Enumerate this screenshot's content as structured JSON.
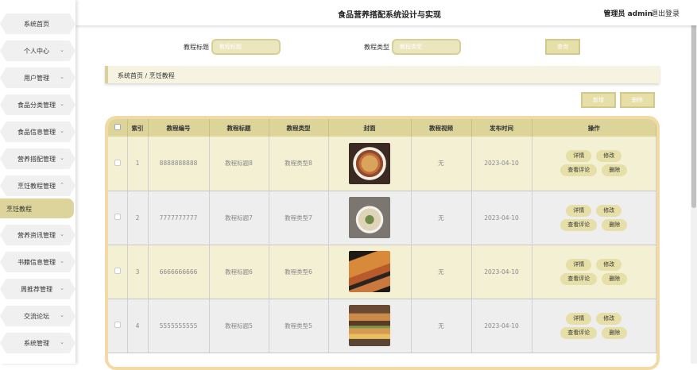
{
  "header": {
    "title": "食品营养搭配系统设计与实现",
    "user": "管理员 admin",
    "logout": "退出登录"
  },
  "sidebar": {
    "items": [
      {
        "label": "系统首页",
        "chevron": false
      },
      {
        "label": "个人中心",
        "chevron": true
      },
      {
        "label": "用户管理",
        "chevron": true
      },
      {
        "label": "食品分类管理",
        "chevron": true
      },
      {
        "label": "食品信息管理",
        "chevron": true
      },
      {
        "label": "营养搭配管理",
        "chevron": true
      },
      {
        "label": "烹饪教程管理",
        "chevron": true,
        "expanded": true
      },
      {
        "label": "营养资讯管理",
        "chevron": true
      },
      {
        "label": "书籍信息管理",
        "chevron": true
      },
      {
        "label": "周推荐管理",
        "chevron": true
      },
      {
        "label": "交流论坛",
        "chevron": true
      },
      {
        "label": "系统管理",
        "chevron": true
      }
    ],
    "active_sub": "烹饪教程"
  },
  "search": {
    "title_label": "教程标题",
    "title_placeholder": "教程标题",
    "type_label": "教程类型",
    "type_placeholder": "教程类型",
    "query_button": "查询"
  },
  "breadcrumb": {
    "text": "系统首页 / 烹饪教程"
  },
  "actions": {
    "add": "新增",
    "delete": "删除"
  },
  "table": {
    "headers": [
      "索引",
      "教程编号",
      "教程标题",
      "教程类型",
      "封面",
      "教程视频",
      "发布时间",
      "操作"
    ],
    "rows": [
      {
        "index": "1",
        "code": "8888888888",
        "title": "教程标题8",
        "type": "教程类型8",
        "video": "无",
        "date": "2023-04-10",
        "cover": "noodle-dish"
      },
      {
        "index": "2",
        "code": "7777777777",
        "title": "教程标题7",
        "type": "教程类型7",
        "video": "无",
        "date": "2023-04-10",
        "cover": "plated-meal"
      },
      {
        "index": "3",
        "code": "6666666666",
        "title": "教程标题6",
        "type": "教程类型6",
        "video": "无",
        "date": "2023-04-10",
        "cover": "pizza-skewers"
      },
      {
        "index": "4",
        "code": "5555555555",
        "title": "教程标题5",
        "type": "教程类型5",
        "video": "无",
        "date": "2023-04-10",
        "cover": "burger-fries"
      }
    ],
    "op_labels": {
      "detail": "详情",
      "edit": "修改",
      "comments": "查看评论",
      "delete": "删除"
    }
  },
  "colors": {
    "accent": "#ddd49a",
    "table_border": "#f2d9a6",
    "row_odd": "#f3f0d4",
    "row_even": "#eeeeee"
  }
}
